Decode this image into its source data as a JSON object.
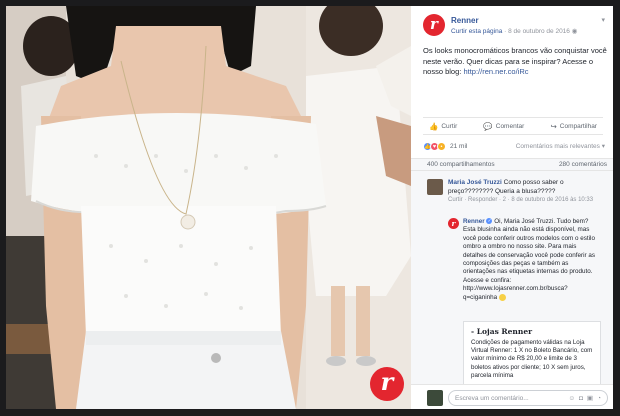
{
  "post": {
    "page_name": "Renner",
    "like_page": "Curtir esta página",
    "date": "8 de outubro de 2016",
    "text": "Os looks monocromáticos brancos vão conquistar você neste verão. Quer dicas para se inspirar? Acesse o nosso blog: ",
    "link": "http://ren.ner.co/iRc"
  },
  "actions": {
    "like": "Curtir",
    "comment": "Comentar",
    "share": "Compartilhar"
  },
  "reactions": {
    "count": "21 mil",
    "sort": "Comentários mais relevantes"
  },
  "stats": {
    "shares": "400 compartilhamentos",
    "comments": "280 comentários"
  },
  "comments": [
    {
      "author": "Maria José Truzzi",
      "text": "Como posso saber o preço???????? Queria a blusa?????",
      "actions": "Curtir · Responder · 2 · 8 de outubro de 2016 às 10:33"
    }
  ],
  "reply": {
    "author": "Renner",
    "text": "Oi, Maria José Truzzi. Tudo bem? Esta blusinha ainda não está disponível, mas você pode conferir outros modelos com o estilo ombro a ombro no nosso site. Para mais detalhes de conservação você pode conferir as composições das peças e também as orientações nas etiquetas internas do produto. Acesse e confira: http://www.lojasrenner.com.br/busca?q=ciganinha"
  },
  "preview": {
    "title": "- Lojas Renner",
    "body": "Condições de pagamento válidas na Loja Virtual Renner: 1 X no Boleto Bancário, com valor mínimo de R$ 20,00 e limite de 3 boletos ativos por cliente; 10 X sem juros, parcela mínima"
  },
  "composer": {
    "placeholder": "Escreva um comentário..."
  },
  "colors": {
    "brand": "#e3262f",
    "link": "#365899"
  },
  "icons": {
    "logo": "renner-r-logo",
    "like": "thumbs-up-icon",
    "comment": "speech-bubble-icon",
    "share": "share-arrow-icon"
  }
}
